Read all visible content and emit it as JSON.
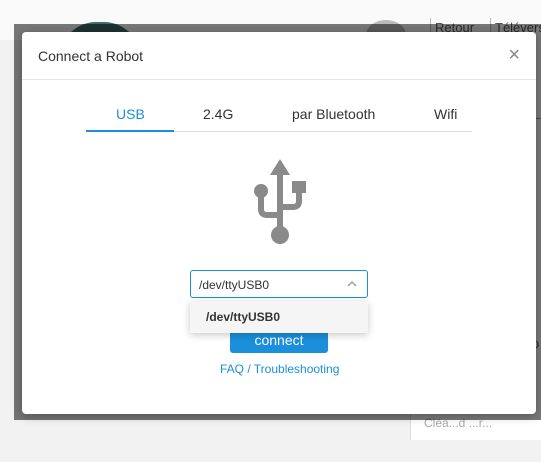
{
  "background": {
    "top_buttons": [
      "Retour",
      "Téléverser"
    ],
    "glyphs": [
      "p",
      "("
    ],
    "bottom_text": "Cléa...d ...r..."
  },
  "modal": {
    "title": "Connect a Robot",
    "close_label": "×",
    "tabs": [
      {
        "label": "USB",
        "active": true
      },
      {
        "label": "2.4G",
        "active": false
      },
      {
        "label": "par Bluetooth",
        "active": false
      },
      {
        "label": "Wifi",
        "active": false
      }
    ],
    "icon": "usb-icon",
    "port_select": {
      "value": "/dev/ttyUSB0",
      "options": [
        "/dev/ttyUSB0"
      ]
    },
    "connect_label": "connect",
    "faq_label": "FAQ / Troubleshooting"
  },
  "colors": {
    "accent": "#1a8fdb",
    "overlay": "rgba(0,0,0,0.52)",
    "icon_gray": "#8a8a8a"
  }
}
